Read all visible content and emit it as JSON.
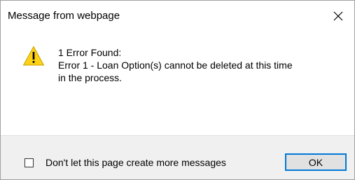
{
  "dialog": {
    "title": "Message from webpage",
    "close_icon": "close-icon",
    "warning_icon": "warning-icon",
    "message_lines": [
      "1 Error Found:",
      "Error 1 - Loan Option(s) cannot be deleted at this time",
      "in the process."
    ],
    "checkbox_label": "Don't let this page create more messages",
    "checkbox_checked": false,
    "ok_label": "OK"
  },
  "colors": {
    "warning_fill": "#fcd116",
    "warning_outline": "#c8a200",
    "accent": "#0078d7",
    "footer_bg": "#f0f0f0"
  }
}
